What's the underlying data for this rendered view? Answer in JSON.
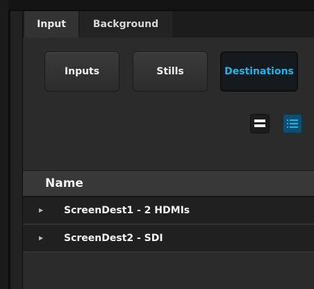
{
  "tabs": {
    "input_label": "Input",
    "background_label": "Background"
  },
  "segments": {
    "inputs_label": "Inputs",
    "stills_label": "Stills",
    "destinations_label": "Destinations",
    "selected": "Destinations"
  },
  "view_toggle": {
    "selected": "detail-list",
    "accent_color": "#1fb4ee"
  },
  "table": {
    "columns": [
      "Name"
    ],
    "rows": [
      {
        "label": "ScreenDest1 - 2 HDMIs"
      },
      {
        "label": "ScreenDest2 - SDI"
      }
    ]
  }
}
